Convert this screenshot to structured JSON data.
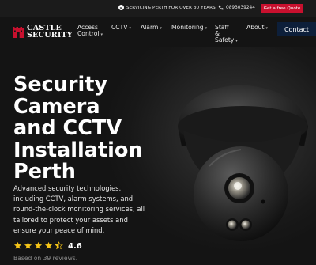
{
  "topbar": {
    "since_text": "SERVICING PERTH FOR OVER 30 YEARS",
    "phone": "0893039244",
    "quote_button": "Get a free Quote"
  },
  "brand": {
    "line1": "CASTLE",
    "line2": "SECURITY",
    "accent_color": "#c8102e"
  },
  "nav": {
    "items": [
      {
        "line1": "Access",
        "line2": "Control",
        "line3": "",
        "dropdown": true
      },
      {
        "line1": "CCTV",
        "line2": "",
        "line3": "",
        "dropdown": true
      },
      {
        "line1": "Alarm",
        "line2": "",
        "line3": "",
        "dropdown": true
      },
      {
        "line1": "Monitoring",
        "line2": "",
        "line3": "",
        "dropdown": true
      },
      {
        "line1": "Staff",
        "line2": "&",
        "line3": "Safety",
        "dropdown": true
      },
      {
        "line1": "About",
        "line2": "",
        "line3": "",
        "dropdown": true
      }
    ],
    "contact_button": "Contact",
    "contact_color": "#0d1f3a"
  },
  "hero": {
    "title_lines": [
      "Security",
      "Camera",
      "and CCTV",
      "Installation",
      "Perth"
    ],
    "description": "Advanced security technologies, including CCTV, alarm systems, and round-the-clock monitoring services, all tailored to protect your assets and ensure your peace of mind.",
    "rating_value": "4.6",
    "rating_stars": 4.5,
    "reviews_text": "Based on 39 reviews.",
    "star_color": "#f5c518"
  }
}
